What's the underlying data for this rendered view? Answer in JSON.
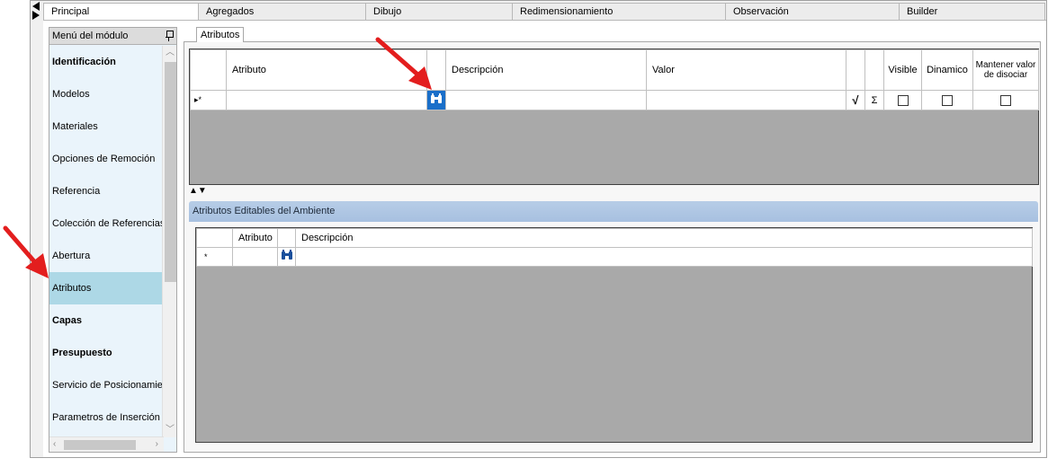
{
  "top_tabs": [
    {
      "label": "Principal",
      "active": true
    },
    {
      "label": "Agregados"
    },
    {
      "label": "Dibujo"
    },
    {
      "label": "Redimensionamiento"
    },
    {
      "label": "Observación"
    },
    {
      "label": "Builder"
    }
  ],
  "sidebar": {
    "title": "Menú del módulo",
    "items": [
      {
        "label": "Identificación",
        "bold": true
      },
      {
        "label": "Modelos"
      },
      {
        "label": "Materiales"
      },
      {
        "label": "Opciones de Remoción"
      },
      {
        "label": "Referencia"
      },
      {
        "label": "Colección de Referencias"
      },
      {
        "label": "Abertura"
      },
      {
        "label": "Atributos",
        "selected": true
      },
      {
        "label": "Capas",
        "bold": true
      },
      {
        "label": "Presupuesto",
        "bold": true
      },
      {
        "label": "Servicio de Posicionamiento"
      },
      {
        "label": "Parametros de Inserción"
      }
    ]
  },
  "content": {
    "tab_label": "Atributos",
    "grid1": {
      "columns": {
        "atributo": "Atributo",
        "descripcion": "Descripción",
        "valor": "Valor",
        "visible": "Visible",
        "dinamico": "Dinamico",
        "mantener": "Mantener valor de disociar"
      },
      "new_row_indicator": "▸*",
      "sigma": "Σ",
      "sqrt": "√"
    },
    "splitter_glyph": "▲▼",
    "group_title": "Atributos Editables del Ambiente",
    "grid2": {
      "columns": {
        "atributo": "Atributo",
        "descripcion": "Descripción"
      },
      "new_row_indicator": "*"
    }
  },
  "colors": {
    "selected": "#add8e6",
    "lookup_button": "#1a6fc9",
    "annotation_arrow": "#e31e1e",
    "group_header": "#b7cde7"
  }
}
